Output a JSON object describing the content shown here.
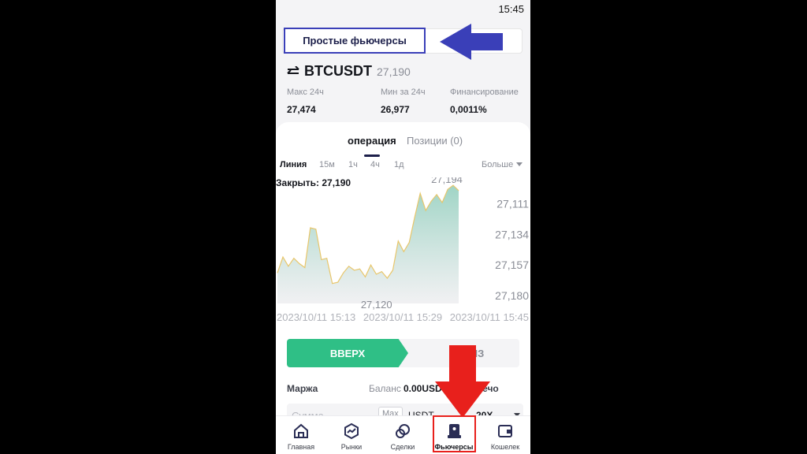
{
  "status_bar": {
    "time": "15:45"
  },
  "mode": {
    "active_label": "Простые фьючерсы"
  },
  "pair": {
    "name": "BTCUSDT",
    "price": "27,190"
  },
  "stats": [
    {
      "label": "Макс 24ч",
      "value": "27,474"
    },
    {
      "label": "Мин за 24ч",
      "value": "26,977"
    },
    {
      "label": "Финансирование",
      "value": "0,0011%"
    }
  ],
  "tabs": [
    {
      "label": "операция",
      "active": true
    },
    {
      "label": "Позиции (0)",
      "active": false
    }
  ],
  "intervals": [
    "Линия",
    "15м",
    "1ч",
    "4ч",
    "1д"
  ],
  "intervals_active": "Линия",
  "more_label": "Больше",
  "chart": {
    "close_label": "Закрыть: 27,190",
    "y_ticks": [
      "27,180",
      "27,157",
      "27,134",
      "27,111"
    ],
    "x_ticks": [
      "2023/10/11 15:13",
      "2023/10/11 15:29",
      "2023/10/11 15:45"
    ],
    "max_label": "27,194",
    "min_label": "27,120"
  },
  "chart_data": {
    "type": "area",
    "title": "",
    "xlabel": "",
    "ylabel": "",
    "x_ticks": [
      "2023/10/11 15:13",
      "2023/10/11 15:29",
      "2023/10/11 15:45"
    ],
    "y_ticks": [
      27111,
      27134,
      27157,
      27180
    ],
    "ylim": [
      27105,
      27200
    ],
    "values": [
      27128,
      27140,
      27133,
      27139,
      27135,
      27132,
      27162,
      27161,
      27138,
      27139,
      27120,
      27121,
      27128,
      27133,
      27130,
      27131,
      27125,
      27134,
      27127,
      27129,
      27124,
      27130,
      27152,
      27144,
      27151,
      27170,
      27188,
      27175,
      27182,
      27187,
      27181,
      27191,
      27194,
      27190
    ],
    "annotations": [
      "27,194",
      "27,120",
      "Закрыть: 27,190"
    ],
    "grid": false
  },
  "trade": {
    "up_label": "ВВЕРХ",
    "down_label": "ВНИЗ"
  },
  "margin": {
    "label": "Маржа",
    "balance_label": "Баланс",
    "balance_value": "0.00USDT",
    "leverage_label": "Плечо"
  },
  "amount": {
    "placeholder": "Сумма",
    "max_label": "Max",
    "currency": "USDT",
    "leverage": "20X"
  },
  "nav": [
    {
      "label": "Главная",
      "icon": "home-icon"
    },
    {
      "label": "Рынки",
      "icon": "markets-icon"
    },
    {
      "label": "Сделки",
      "icon": "trades-icon"
    },
    {
      "label": "Фьючерсы",
      "icon": "futures-icon",
      "active": true
    },
    {
      "label": "Кошелек",
      "icon": "wallet-icon"
    }
  ],
  "colors": {
    "accent": "#1c1f4a",
    "up_green": "#2fbf86",
    "chart_line": "#e8c66a",
    "highlight_blue": "#3a3fb8",
    "highlight_red": "#e8201c"
  }
}
